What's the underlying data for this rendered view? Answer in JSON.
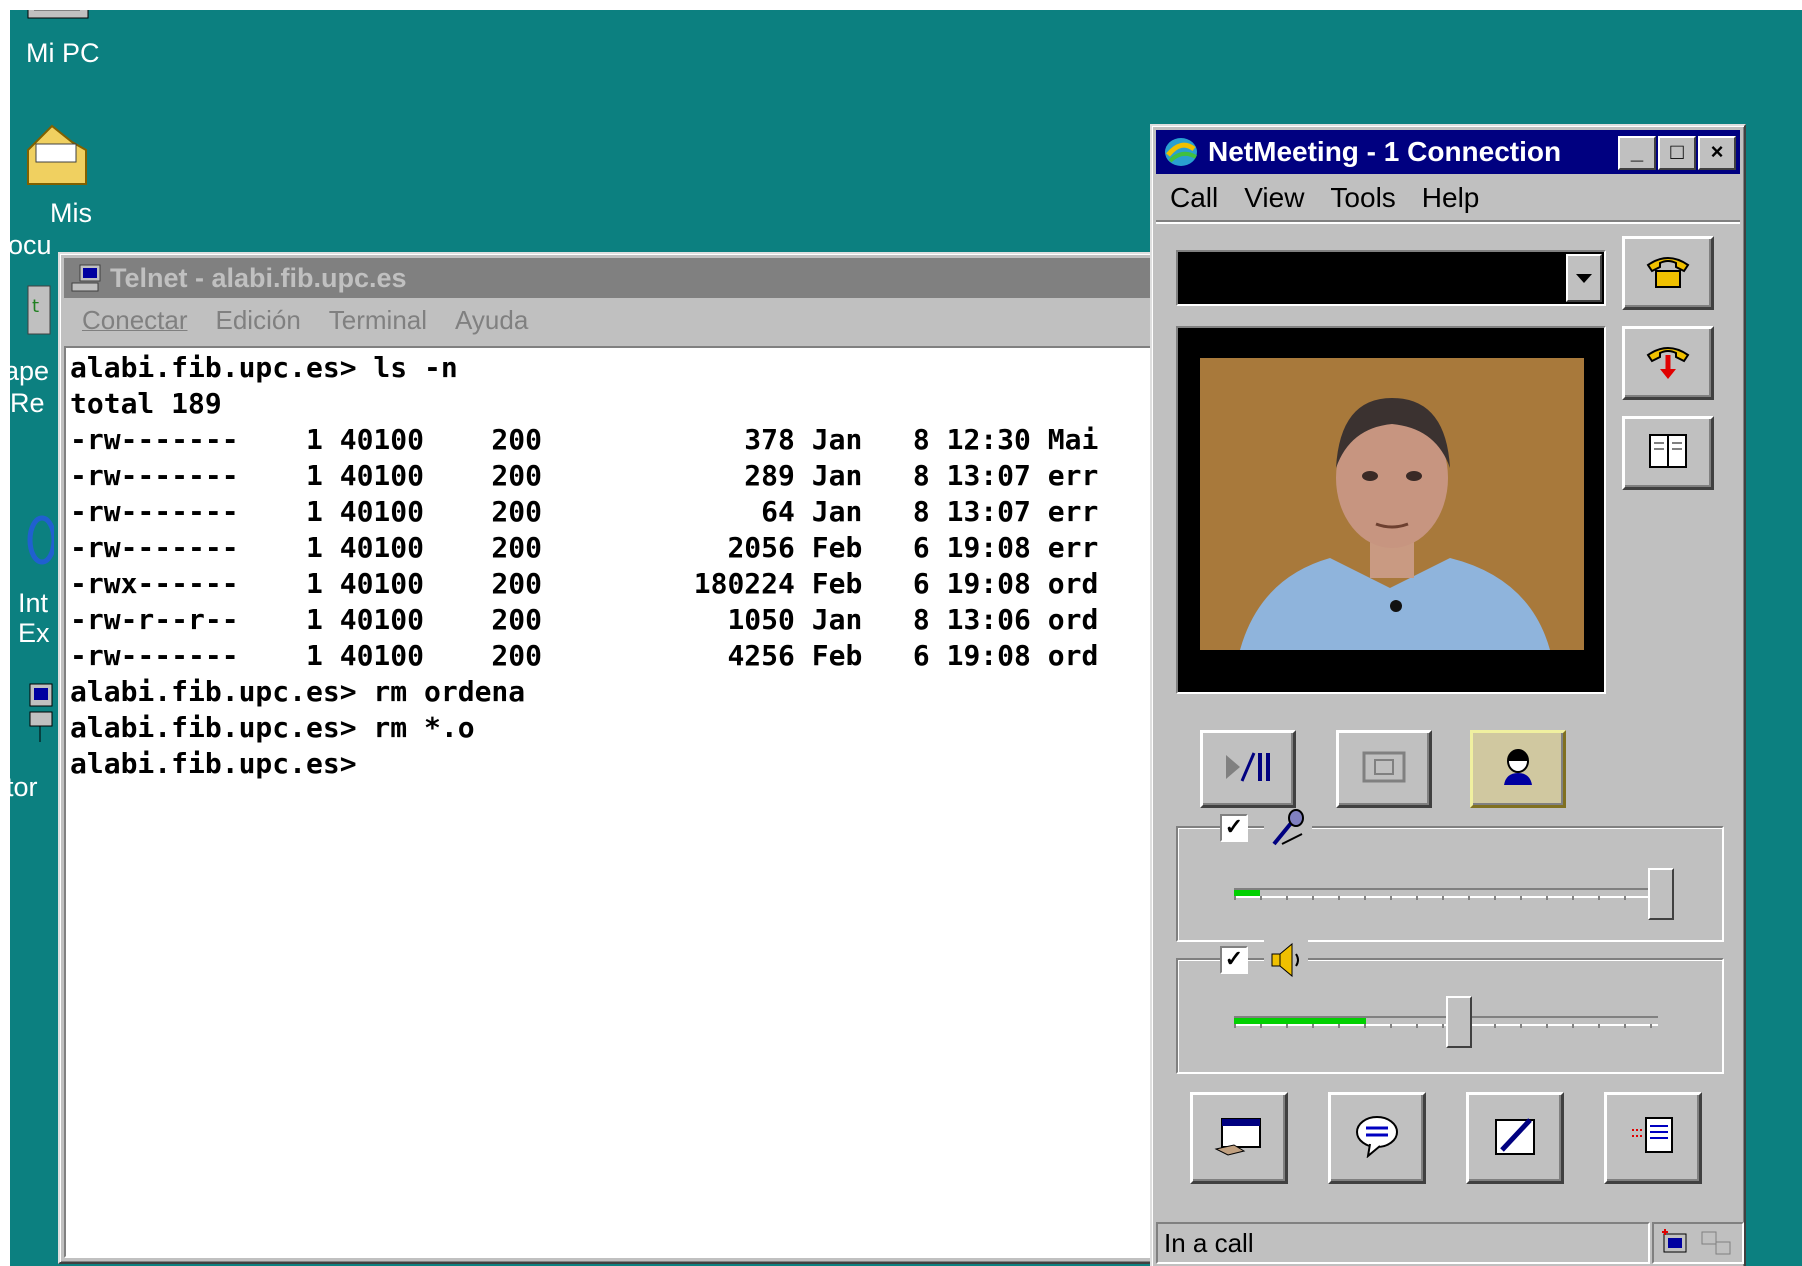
{
  "desktop": {
    "icons": [
      {
        "label": "Mi PC"
      },
      {
        "label": "Mis"
      },
      {
        "label": "ocu"
      },
      {
        "label": "ape"
      },
      {
        "label": "Re"
      },
      {
        "label": "Int"
      },
      {
        "label": "Ex"
      },
      {
        "label": "tor"
      }
    ]
  },
  "telnet": {
    "title": "Telnet - alabi.fib.upc.es",
    "menu": [
      "Conectar",
      "Edición",
      "Terminal",
      "Ayuda"
    ],
    "lines": [
      "alabi.fib.upc.es> ls -n",
      "total 189",
      "-rw-------    1 40100    200            378 Jan   8 12:30 Mai",
      "-rw-------    1 40100    200            289 Jan   8 13:07 err",
      "-rw-------    1 40100    200             64 Jan   8 13:07 err",
      "-rw-------    1 40100    200           2056 Feb   6 19:08 err",
      "-rwx------    1 40100    200         180224 Feb   6 19:08 ord",
      "-rw-r--r--    1 40100    200           1050 Jan   8 13:06 ord",
      "-rw-------    1 40100    200           4256 Feb   6 19:08 ord",
      "alabi.fib.upc.es> rm ordena",
      "alabi.fib.upc.es> rm *.o",
      "alabi.fib.upc.es>"
    ]
  },
  "netmeeting": {
    "title": "NetMeeting - 1 Connection",
    "window_buttons": [
      "_",
      "□",
      "×"
    ],
    "menu": [
      "Call",
      "View",
      "Tools",
      "Help"
    ],
    "address_value": "",
    "microphone": {
      "enabled": true,
      "level": 0.06,
      "volume": 0.98
    },
    "speaker": {
      "enabled": true,
      "level": 0.3,
      "volume": 0.48
    },
    "status": "In a call",
    "colors": {
      "title_active": "#000080",
      "desktop": "#0c8080",
      "level": "#00d000"
    }
  }
}
